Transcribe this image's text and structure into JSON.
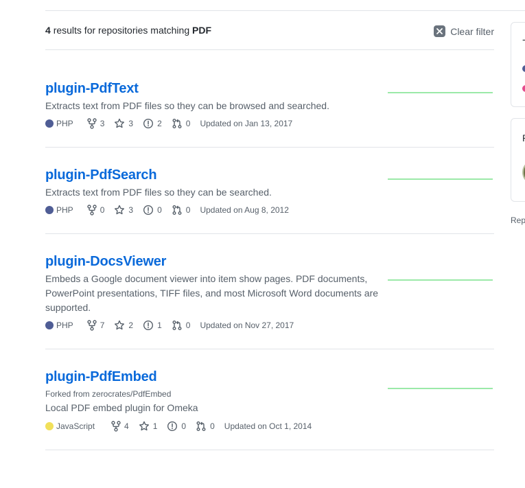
{
  "results": {
    "count": "4",
    "text_middle": "results for repositories matching",
    "query": "PDF",
    "clear_filter_label": "Clear filter"
  },
  "repos": [
    {
      "name": "plugin-PdfText",
      "forked_from": "",
      "description": "Extracts text from PDF files so they can be browsed and searched.",
      "language": "PHP",
      "language_color": "#4F5D95",
      "forks": "3",
      "stars": "3",
      "issues": "2",
      "pulls": "0",
      "updated": "Updated on Jan 13, 2017"
    },
    {
      "name": "plugin-PdfSearch",
      "forked_from": "",
      "description": "Extracts text from PDF files so they can be searched.",
      "language": "PHP",
      "language_color": "#4F5D95",
      "forks": "0",
      "stars": "3",
      "issues": "0",
      "pulls": "0",
      "updated": "Updated on Aug 8, 2012"
    },
    {
      "name": "plugin-DocsViewer",
      "forked_from": "",
      "description": "Embeds a Google document viewer into item show pages. PDF documents, PowerPoint presentations, TIFF files, and most Microsoft Word documents are supported.",
      "language": "PHP",
      "language_color": "#4F5D95",
      "forks": "7",
      "stars": "2",
      "issues": "1",
      "pulls": "0",
      "updated": "Updated on Nov 27, 2017"
    },
    {
      "name": "plugin-PdfEmbed",
      "forked_from": "Forked from zerocrates/PdfEmbed",
      "description": "Local PDF embed plugin for Omeka",
      "language": "JavaScript",
      "language_color": "#f1e05a",
      "forks": "4",
      "stars": "1",
      "issues": "0",
      "pulls": "0",
      "updated": "Updated on Oct 1, 2014"
    }
  ],
  "sidebar": {
    "languages_box": {
      "dot_colors": [
        "#4F5D95",
        "#e44b8d"
      ]
    },
    "people_box": {
      "title_char": "P"
    },
    "footer_text": "Rep"
  }
}
